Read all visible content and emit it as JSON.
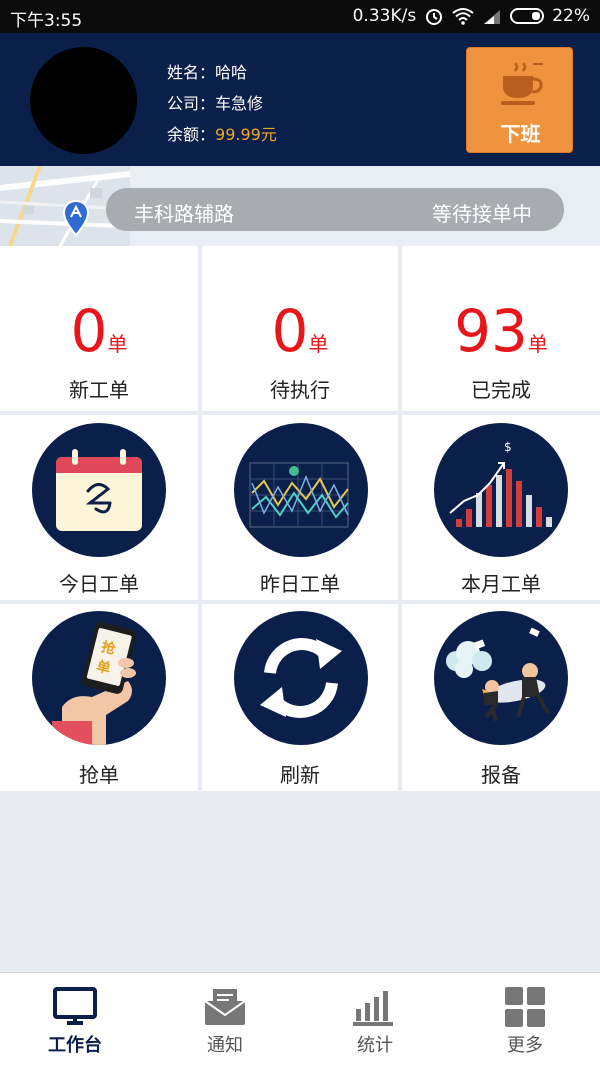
{
  "status_bar": {
    "time": "下午3:55",
    "speed": "0.33K/s",
    "battery": "22%"
  },
  "header": {
    "name_label": "姓名：",
    "name_value": "哈哈",
    "company_label": "公司：",
    "company_value": "车急修",
    "balance_label": "余额：",
    "balance_value": "99.99元",
    "off_work_label": "下班"
  },
  "location": {
    "road": "丰科路辅路",
    "status": "等待接单中"
  },
  "stats": [
    {
      "value": "0",
      "unit": "单",
      "label": "新工单"
    },
    {
      "value": "0",
      "unit": "单",
      "label": "待执行"
    },
    {
      "value": "93",
      "unit": "单",
      "label": "已完成"
    }
  ],
  "actions": [
    {
      "label": "今日工单",
      "icon": "calendar-icon"
    },
    {
      "label": "昨日工单",
      "icon": "line-chart-icon"
    },
    {
      "label": "本月工单",
      "icon": "bar-chart-icon"
    },
    {
      "label": "抢单",
      "icon": "phone-grab-icon"
    },
    {
      "label": "刷新",
      "icon": "refresh-icon"
    },
    {
      "label": "报备",
      "icon": "rocket-report-icon"
    }
  ],
  "phone_text": "抢单",
  "tabs": [
    {
      "label": "工作台",
      "icon": "monitor-icon",
      "active": true
    },
    {
      "label": "通知",
      "icon": "mail-icon",
      "active": false
    },
    {
      "label": "统计",
      "icon": "stats-icon",
      "active": false
    },
    {
      "label": "更多",
      "icon": "grid-icon",
      "active": false
    }
  ],
  "colors": {
    "navy": "#0a1f4a",
    "accent_orange": "#f0933e",
    "number_red": "#e8151a",
    "money_yellow": "#f5a623"
  }
}
